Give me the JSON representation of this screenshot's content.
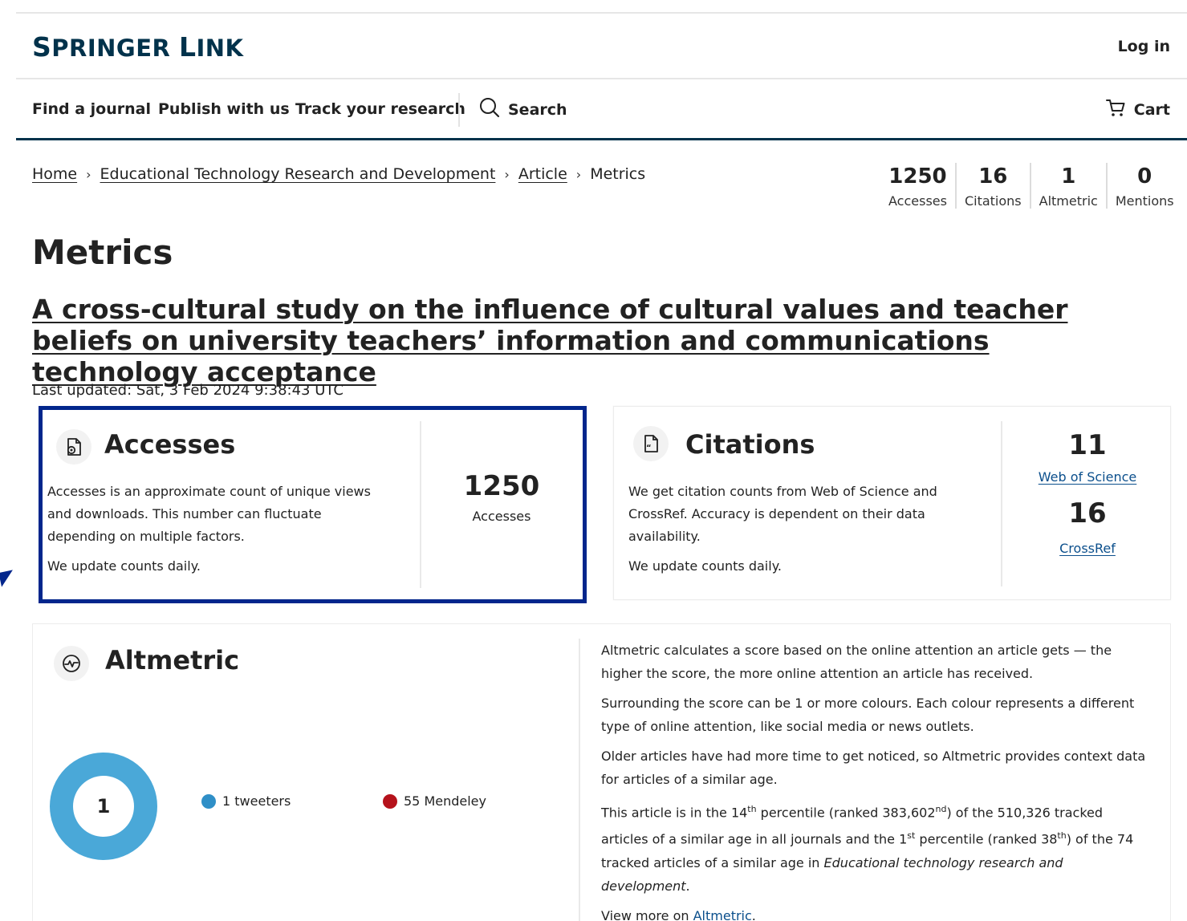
{
  "brand": {
    "logo_part1": "S",
    "logo_part2": "PRINGER ",
    "logo_part3": "L",
    "logo_part4": "INK"
  },
  "header": {
    "login_label": "Log in"
  },
  "nav": {
    "items": [
      "Find a journal",
      "Publish with us",
      "Track your research"
    ],
    "search_label": "Search",
    "cart_label": "Cart"
  },
  "breadcrumb": {
    "items": [
      "Home",
      "Educational Technology Research and Development",
      "Article",
      "Metrics"
    ]
  },
  "summary_stats": [
    {
      "value": "1250",
      "label": "Accesses"
    },
    {
      "value": "16",
      "label": "Citations"
    },
    {
      "value": "1",
      "label": "Altmetric"
    },
    {
      "value": "0",
      "label": "Mentions"
    }
  ],
  "page_title": "Metrics",
  "article_title": "A cross-cultural study on the influence of cultural values and teacher beliefs on university teachers’ information and communications technology acceptance",
  "last_updated": "Last updated: Sat, 3 Feb 2024 9:38:43 UTC",
  "accesses": {
    "title": "Accesses",
    "description": "Accesses is an approximate count of unique views and downloads. This number can fluctuate depending on multiple factors.",
    "update_note": "We update counts daily.",
    "value": "1250",
    "value_label": "Accesses"
  },
  "citations": {
    "title": "Citations",
    "description": "We get citation counts from Web of Science and CrossRef. Accuracy is dependent on their data availability.",
    "update_note": "We update counts daily.",
    "sources": [
      {
        "value": "11",
        "label": "Web of Science"
      },
      {
        "value": "16",
        "label": "CrossRef"
      }
    ]
  },
  "altmetric": {
    "title": "Altmetric",
    "score": "1",
    "legend": [
      {
        "label": "1 tweeters",
        "color": "#2f8fc7"
      },
      {
        "label": "55 Mendeley",
        "color": "#b5121b"
      }
    ],
    "donut_color": "#4aa8d8",
    "para1": "Altmetric calculates a score based on the online attention an article gets — the higher the score, the more online attention an article has received.",
    "para2": "Surrounding the score can be 1 or more colours. Each colour represents a different type of online attention, like social media or news outlets.",
    "para3": "Older articles have had more time to get noticed, so Altmetric provides context data for articles of a similar age.",
    "para4_a": "This article is in the 14",
    "para4_sup1": "th",
    "para4_b": " percentile (ranked 383,602",
    "para4_sup2": "nd",
    "para4_c": ") of the 510,326 tracked articles of a similar age in all journals and the 1",
    "para4_sup3": "st",
    "para4_d": " percentile (ranked 38",
    "para4_sup4": "th",
    "para4_e": ") of the 74 tracked articles of a similar age in ",
    "para4_journal": "Educational technology research and development",
    "para4_end": ".",
    "view_more_prefix": "View more on ",
    "view_more_link": "Altmetric",
    "view_more_suffix": "."
  },
  "colors": {
    "brand": "#01324b",
    "highlight_border": "#02268c",
    "link": "#0b4f8c"
  }
}
